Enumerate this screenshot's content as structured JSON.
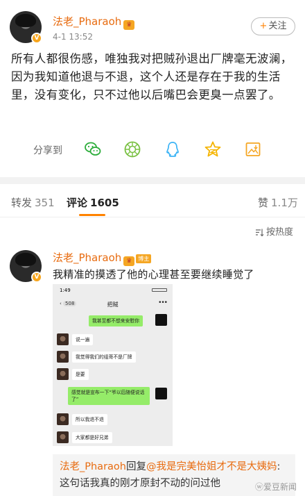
{
  "post": {
    "username": "法老_Pharaoh",
    "time": "4-1 13:52",
    "follow_label": "关注",
    "text": "所有人都很伤感，唯独我对把贼孙退出厂牌毫无波澜，因为我知道他退与不退，这个人还是存在于我的生活里，没有变化，只不过他以后嘴巴会更臭一点罢了。"
  },
  "share": {
    "label": "分享到",
    "icons": [
      "wechat-icon",
      "moments-icon",
      "qq-icon",
      "qzone-icon",
      "save-image-icon"
    ],
    "colors": {
      "wechat": "#2bad3a",
      "moments": "#7ac143",
      "qq": "#3bb3f5",
      "qzone": "#f5b400",
      "save": "#f5a623"
    }
  },
  "tabs": [
    {
      "label": "转发",
      "count": "351"
    },
    {
      "label": "评论",
      "count": "1605"
    },
    {
      "label": "赞",
      "count": "1.1万"
    }
  ],
  "sort_label": "按热度",
  "comment": {
    "username": "法老_Pharaoh",
    "badge": "博主",
    "text": "我精准的摸透了他的心理甚至要继续睡觉了"
  },
  "chat": {
    "time": "1:49",
    "back": "508",
    "title": "把贼",
    "messages": [
      {
        "side": "out",
        "text": "我甚至都不想来安慰你"
      },
      {
        "side": "in",
        "text": "说一遍"
      },
      {
        "side": "in",
        "text": "我觉得我们的组哥不是厂牌"
      },
      {
        "side": "in",
        "text": "是要"
      },
      {
        "side": "out",
        "text": "感觉就是宣布一下“爷以后随便说话了”"
      },
      {
        "side": "in",
        "text": "所以我退不退"
      },
      {
        "side": "in",
        "text": "大家都是好兄弟"
      }
    ]
  },
  "reply": {
    "user": "法老_Pharaoh",
    "verb": "回复",
    "mention": "@我是完美怡姐才不是大姨妈",
    "text": ":这句话我真的刚才原封不动的问过他"
  },
  "watermark": "爱豆新闻",
  "accent": "#ff8200"
}
